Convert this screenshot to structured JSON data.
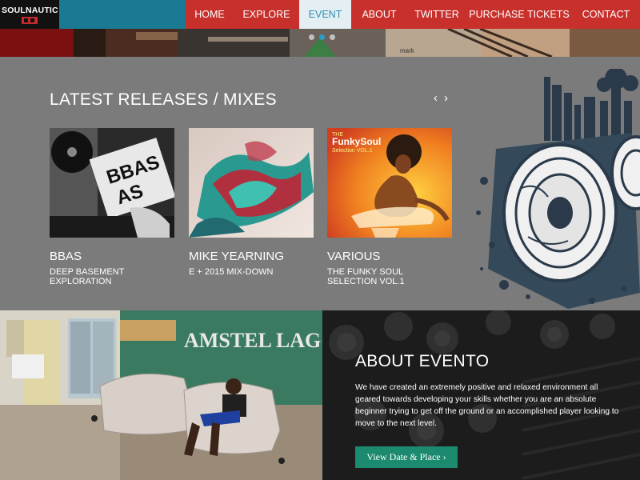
{
  "header": {
    "logo": {
      "text": "SOULNAUTIC"
    },
    "nav": [
      {
        "label": "HOME",
        "active": false
      },
      {
        "label": "EXPLORE",
        "active": false
      },
      {
        "label": "EVENT",
        "active": true
      },
      {
        "label": "ABOUT",
        "active": false
      },
      {
        "label": "TWITTER",
        "active": false
      },
      {
        "label": "PURCHASE TICKETS",
        "active": false
      },
      {
        "label": "CONTACT",
        "active": false
      }
    ]
  },
  "hero": {
    "slide_count": 3,
    "active_slide": 2
  },
  "releases": {
    "title": "LATEST RELEASES / MIXES",
    "prev_arrow": "‹",
    "next_arrow": "›",
    "items": [
      {
        "artist": "BBAS",
        "title": "DEEP BASEMENT EXPLORATION",
        "art_text": "BBAS"
      },
      {
        "artist": "MIKE YEARNING",
        "title": "E + 2015 MIX-DOWN"
      },
      {
        "artist": "VARIOUS",
        "title": "THE FUNKY SOUL SELECTION VOL.1",
        "art_text_top": "THE",
        "art_text_main": "FunkySoul",
        "art_text_sub": "Selection VOL.1"
      }
    ]
  },
  "photo": {
    "sign_text": "AMSTEL LAG"
  },
  "about": {
    "title": "ABOUT EVENTO",
    "text": "We have created an extremely positive and relaxed environment all geared towards developing your skills whether you are an absolute beginner trying to get off the ground or an accomplished player looking to move to the next level.",
    "button_label": "View Date & Place ›"
  },
  "colors": {
    "nav_bg": "#c8302c",
    "teal_band": "#1a7a94",
    "active_nav_bg": "#e4eef3",
    "active_nav_text": "#2d8fb0",
    "section_bg": "#7b7b7b",
    "button_bg": "#1b8a6e"
  }
}
